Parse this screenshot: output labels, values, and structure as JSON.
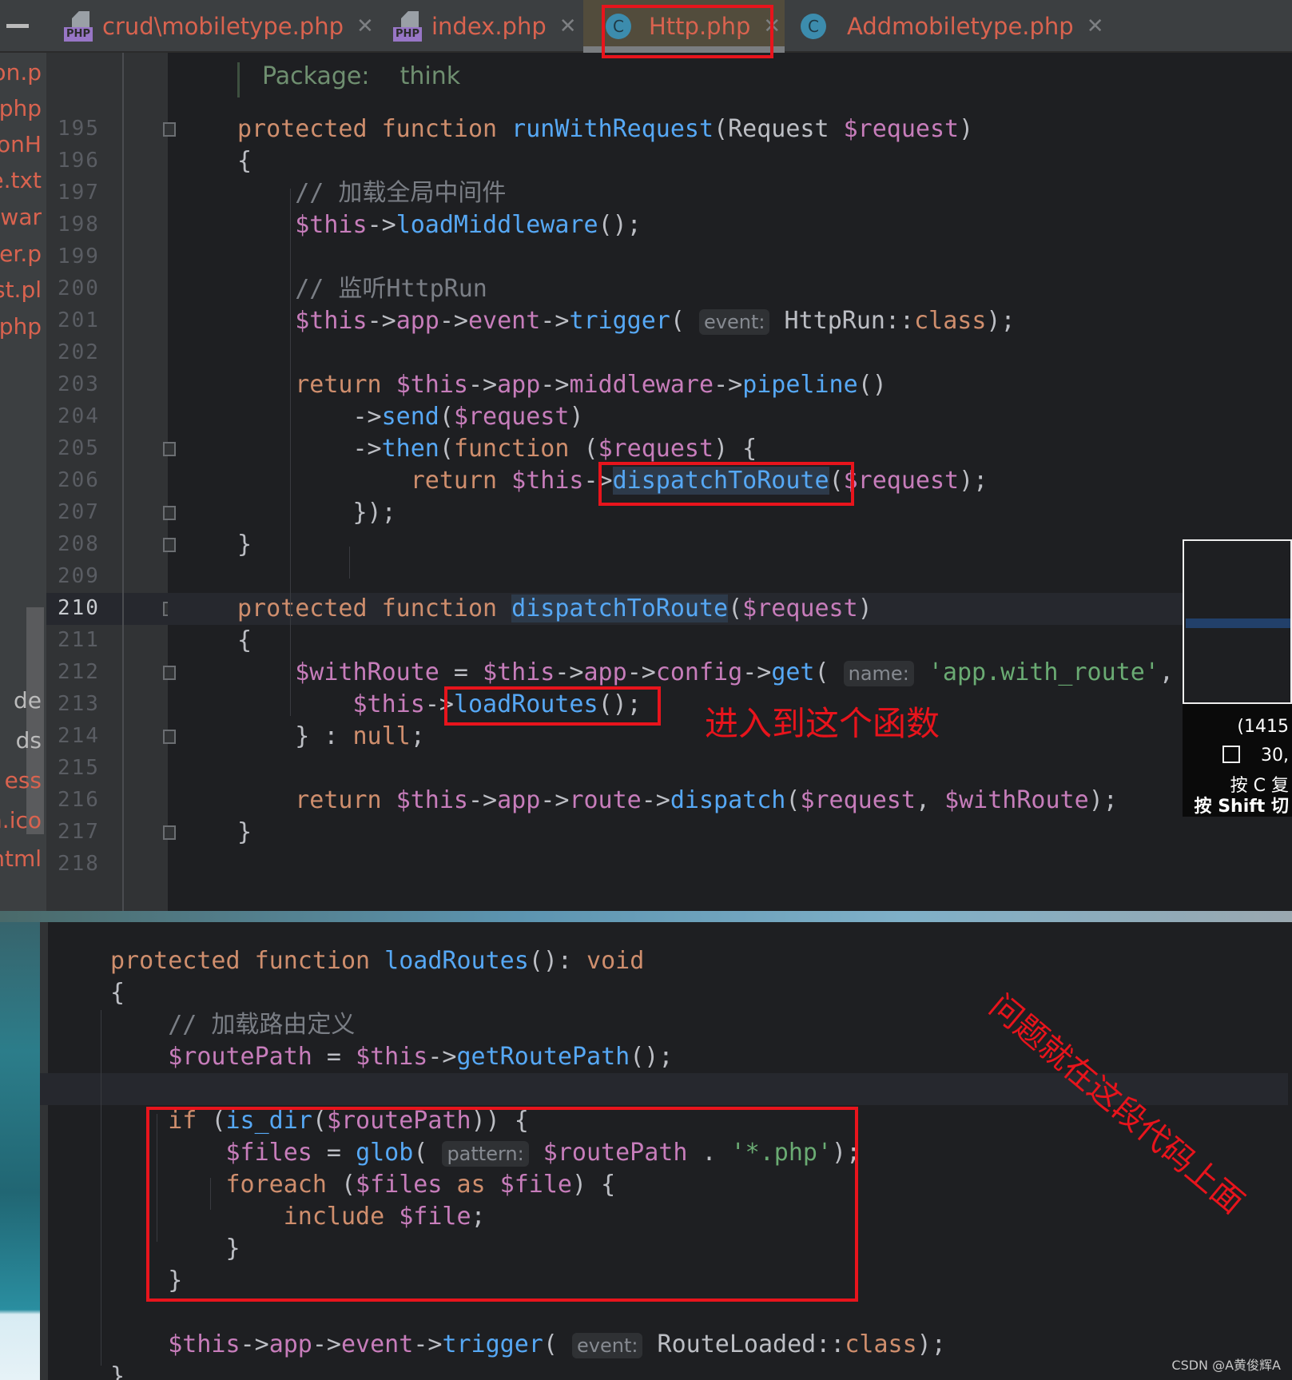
{
  "tabs": [
    {
      "label": "crud\\mobiletype.php",
      "icon": "php-file-icon"
    },
    {
      "label": "index.php",
      "icon": "php-file-icon"
    },
    {
      "label": "Http.php",
      "icon": "class-icon",
      "active": true
    },
    {
      "label": "Addmobiletype.php",
      "icon": "class-icon"
    }
  ],
  "tab_close": "✕",
  "php_icon_label": "PHP",
  "class_icon_label": "C",
  "sidebar": {
    "items_top": [
      "ion.p",
      "php",
      "tionH",
      "e.txt",
      "ewar",
      "der.p",
      "est.pl",
      "e.php"
    ],
    "items_bottom": [
      "de",
      "ds",
      "ess",
      "n.ico",
      "html"
    ]
  },
  "editor": {
    "package_line": "Package:    think",
    "current_line": 210,
    "lines": [
      {
        "n": 195,
        "t": [
          [
            "protected function ",
            "kw"
          ],
          [
            "runWithRequest",
            "fn"
          ],
          [
            "(Request ",
            "pl"
          ],
          [
            "$request",
            "var"
          ],
          [
            ")",
            "pl"
          ]
        ]
      },
      {
        "n": 196,
        "t": [
          [
            "{",
            "pl"
          ]
        ]
      },
      {
        "n": 197,
        "t": [
          [
            "    // 加载全局中间件",
            "cm"
          ]
        ]
      },
      {
        "n": 198,
        "t": [
          [
            "    $this",
            "var"
          ],
          [
            "->",
            "pl"
          ],
          [
            "loadMiddleware",
            "fn"
          ],
          [
            "();",
            "pl"
          ]
        ]
      },
      {
        "n": 199,
        "t": []
      },
      {
        "n": 200,
        "t": [
          [
            "    // 监听HttpRun",
            "cm"
          ]
        ]
      },
      {
        "n": 201,
        "t": [
          [
            "    $this",
            "var"
          ],
          [
            "->",
            "pl"
          ],
          [
            "app",
            "var"
          ],
          [
            "->",
            "pl"
          ],
          [
            "event",
            "var"
          ],
          [
            "->",
            "pl"
          ],
          [
            "trigger",
            "fn"
          ],
          [
            "( ",
            "pl"
          ],
          [
            "event:",
            "hint"
          ],
          [
            " HttpRun::",
            "pl"
          ],
          [
            "class",
            "kw"
          ],
          [
            ");",
            "pl"
          ]
        ]
      },
      {
        "n": 202,
        "t": []
      },
      {
        "n": 203,
        "t": [
          [
            "    return ",
            "kw"
          ],
          [
            "$this",
            "var"
          ],
          [
            "->",
            "pl"
          ],
          [
            "app",
            "var"
          ],
          [
            "->",
            "pl"
          ],
          [
            "middleware",
            "var"
          ],
          [
            "->",
            "pl"
          ],
          [
            "pipeline",
            "fn"
          ],
          [
            "()",
            "pl"
          ]
        ]
      },
      {
        "n": 204,
        "t": [
          [
            "        ->",
            "pl"
          ],
          [
            "send",
            "fn"
          ],
          [
            "(",
            "pl"
          ],
          [
            "$request",
            "var"
          ],
          [
            ")",
            "pl"
          ]
        ]
      },
      {
        "n": 205,
        "t": [
          [
            "        ->",
            "pl"
          ],
          [
            "then",
            "fn"
          ],
          [
            "(",
            "pl"
          ],
          [
            "function ",
            "kw"
          ],
          [
            "(",
            "pl"
          ],
          [
            "$request",
            "var"
          ],
          [
            ") {",
            "pl"
          ]
        ]
      },
      {
        "n": 206,
        "t": [
          [
            "            return ",
            "kw"
          ],
          [
            "$this",
            "var"
          ],
          [
            "->",
            "pl"
          ],
          [
            "dispatchToRoute",
            "fnhl"
          ],
          [
            "(",
            "pl"
          ],
          [
            "$request",
            "var"
          ],
          [
            ");",
            "pl"
          ]
        ]
      },
      {
        "n": 207,
        "t": [
          [
            "        });",
            "pl"
          ]
        ]
      },
      {
        "n": 208,
        "t": [
          [
            "}",
            "pl"
          ]
        ]
      },
      {
        "n": 209,
        "t": []
      },
      {
        "n": 210,
        "t": [
          [
            "protected function ",
            "kw"
          ],
          [
            "dispatchToRoute",
            "fnhl"
          ],
          [
            "(",
            "pl"
          ],
          [
            "$request",
            "var"
          ],
          [
            ")",
            "pl"
          ]
        ]
      },
      {
        "n": 211,
        "t": [
          [
            "{",
            "pl"
          ]
        ]
      },
      {
        "n": 212,
        "t": [
          [
            "    $withRoute",
            "var"
          ],
          [
            " = ",
            "pl"
          ],
          [
            "$this",
            "var"
          ],
          [
            "->",
            "pl"
          ],
          [
            "app",
            "var"
          ],
          [
            "->",
            "pl"
          ],
          [
            "config",
            "var"
          ],
          [
            "->",
            "pl"
          ],
          [
            "get",
            "fn"
          ],
          [
            "( ",
            "pl"
          ],
          [
            "name:",
            "hint"
          ],
          [
            " ",
            "pl"
          ],
          [
            "'app.with_route'",
            "str"
          ],
          [
            ", ",
            "pl"
          ]
        ]
      },
      {
        "n": 213,
        "t": [
          [
            "        $this",
            "var"
          ],
          [
            "->",
            "pl"
          ],
          [
            "loadRoutes",
            "fn"
          ],
          [
            "();",
            "pl"
          ]
        ]
      },
      {
        "n": 214,
        "t": [
          [
            "    } : ",
            "pl"
          ],
          [
            "null",
            "kw"
          ],
          [
            ";",
            "pl"
          ]
        ]
      },
      {
        "n": 215,
        "t": []
      },
      {
        "n": 216,
        "t": [
          [
            "    return ",
            "kw"
          ],
          [
            "$this",
            "var"
          ],
          [
            "->",
            "pl"
          ],
          [
            "app",
            "var"
          ],
          [
            "->",
            "pl"
          ],
          [
            "route",
            "var"
          ],
          [
            "->",
            "pl"
          ],
          [
            "dispatch",
            "fn"
          ],
          [
            "(",
            "pl"
          ],
          [
            "$request",
            "var"
          ],
          [
            ", ",
            "pl"
          ],
          [
            "$withRoute",
            "var"
          ],
          [
            ");",
            "pl"
          ]
        ]
      },
      {
        "n": 217,
        "t": [
          [
            "}",
            "pl"
          ]
        ]
      },
      {
        "n": 218,
        "t": []
      }
    ],
    "fold_lines": [
      195,
      205,
      207,
      208,
      210,
      212,
      214,
      217
    ]
  },
  "editor2": {
    "highlight_row": 4,
    "lines": [
      [
        [
          "protected function ",
          "kw"
        ],
        [
          "loadRoutes",
          "fn"
        ],
        [
          "(): ",
          "pl"
        ],
        [
          "void",
          "kw"
        ]
      ],
      [
        [
          "{",
          "pl"
        ]
      ],
      [
        [
          "    // 加载路由定义",
          "cm"
        ]
      ],
      [
        [
          "    $routePath",
          "var"
        ],
        [
          " = ",
          "pl"
        ],
        [
          "$this",
          "var"
        ],
        [
          "->",
          "pl"
        ],
        [
          "getRoutePath",
          "fn"
        ],
        [
          "();",
          "pl"
        ]
      ],
      [],
      [
        [
          "    if ",
          "kw"
        ],
        [
          "(",
          "pl"
        ],
        [
          "is_dir",
          "fn"
        ],
        [
          "(",
          "pl"
        ],
        [
          "$routePath",
          "var"
        ],
        [
          ")) {",
          "pl"
        ]
      ],
      [
        [
          "        $files",
          "var"
        ],
        [
          " = ",
          "pl"
        ],
        [
          "glob",
          "fn"
        ],
        [
          "( ",
          "pl"
        ],
        [
          "pattern:",
          "hint"
        ],
        [
          " ",
          "pl"
        ],
        [
          "$routePath",
          "var"
        ],
        [
          " . ",
          "pl"
        ],
        [
          "'*.php'",
          "str"
        ],
        [
          ");",
          "pl"
        ]
      ],
      [
        [
          "        foreach ",
          "kw"
        ],
        [
          "(",
          "pl"
        ],
        [
          "$files",
          "var"
        ],
        [
          " as ",
          "kw"
        ],
        [
          "$file",
          "var"
        ],
        [
          ") {",
          "pl"
        ]
      ],
      [
        [
          "            include ",
          "kw"
        ],
        [
          "$file",
          "var"
        ],
        [
          ";",
          "pl"
        ]
      ],
      [
        [
          "        }",
          "pl"
        ]
      ],
      [
        [
          "    }",
          "pl"
        ]
      ],
      [],
      [
        [
          "    $this",
          "var"
        ],
        [
          "->",
          "pl"
        ],
        [
          "app",
          "var"
        ],
        [
          "->",
          "pl"
        ],
        [
          "event",
          "var"
        ],
        [
          "->",
          "pl"
        ],
        [
          "trigger",
          "fn"
        ],
        [
          "( ",
          "pl"
        ],
        [
          "event:",
          "hint"
        ],
        [
          " RouteLoaded::",
          "pl"
        ],
        [
          "class",
          "kw"
        ],
        [
          ");",
          "pl"
        ]
      ],
      [
        [
          "}",
          "pl"
        ]
      ]
    ]
  },
  "annotations": {
    "enter_function": "进入到这个函数",
    "problem_here": "问题就在这段代码上面",
    "color": "#e8141c"
  },
  "screenshot_tool": {
    "coords": "(1415",
    "size": "30,",
    "hint_copy": "按 C 复",
    "hint_shift": "按 Shift 切"
  },
  "watermark": "CSDN @A黄俊辉A"
}
